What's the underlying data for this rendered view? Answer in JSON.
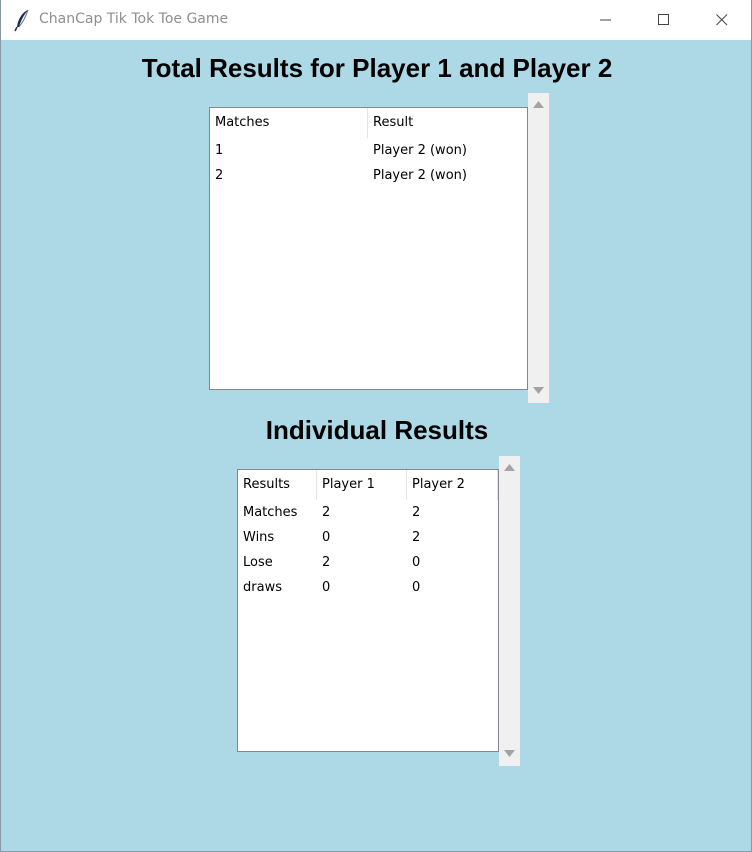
{
  "window": {
    "title": "ChanCap Tik Tok Toe Game",
    "background": "#add8e6"
  },
  "total_results": {
    "heading": "Total Results for Player 1 and Player 2",
    "columns": [
      "Matches",
      "Result"
    ],
    "rows": [
      [
        "1",
        "Player 2 (won)"
      ],
      [
        "2",
        "Player 2 (won)"
      ]
    ]
  },
  "individual_results": {
    "heading": "Individual Results",
    "columns": [
      "Results",
      "Player 1",
      "Player 2"
    ],
    "rows": [
      [
        "Matches",
        "2",
        "2"
      ],
      [
        "Wins",
        "0",
        "2"
      ],
      [
        "Lose",
        "2",
        "0"
      ],
      [
        "draws",
        "0",
        "0"
      ]
    ]
  },
  "icons": {
    "app": "feather-icon",
    "minimize": "minimize-icon",
    "maximize": "maximize-icon",
    "close": "close-icon",
    "scroll_up": "scroll-up-arrow-icon",
    "scroll_down": "scroll-down-arrow-icon"
  }
}
